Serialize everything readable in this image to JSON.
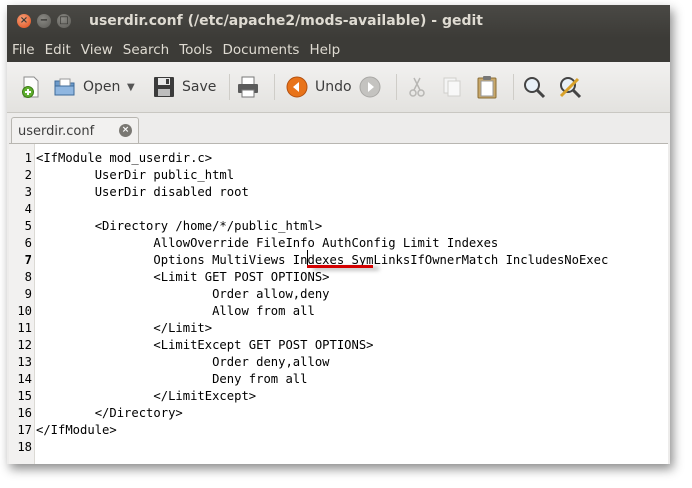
{
  "window": {
    "title": "userdir.conf (/etc/apache2/mods-available) - gedit",
    "controls": {
      "close": "×",
      "minimize": "−",
      "maximize": "□"
    }
  },
  "menubar": [
    "File",
    "Edit",
    "View",
    "Search",
    "Tools",
    "Documents",
    "Help"
  ],
  "toolbar": {
    "new_icon": "new-document-icon",
    "open_label": "Open",
    "save_label": "Save",
    "print_icon": "printer-icon",
    "undo_label": "Undo",
    "redo_icon": "redo-icon",
    "cut_icon": "scissors-icon",
    "copy_icon": "copy-icon",
    "paste_icon": "clipboard-icon",
    "find_icon": "magnifier-icon",
    "replace_icon": "find-replace-icon",
    "dropdown_arrow": "▼"
  },
  "tab": {
    "label": "userdir.conf",
    "close_glyph": "×"
  },
  "editor": {
    "lines": [
      "<IfModule mod_userdir.c>",
      "        UserDir public_html",
      "        UserDir disabled root",
      "",
      "        <Directory /home/*/public_html>",
      "                AllowOverride FileInfo AuthConfig Limit Indexes",
      "                Options MultiViews Indexes SymLinksIfOwnerMatch IncludesNoExec",
      "                <Limit GET POST OPTIONS>",
      "                        Order allow,deny",
      "                        Allow from all",
      "                </Limit>",
      "                <LimitExcept GET POST OPTIONS>",
      "                        Order deny,allow",
      "                        Deny from all",
      "                </LimitExcept>",
      "        </Directory>",
      "</IfModule>",
      ""
    ],
    "line_numbers": [
      "1",
      "2",
      "3",
      "4",
      "5",
      "6",
      "7",
      "8",
      "9",
      "10",
      "11",
      "12",
      "13",
      "14",
      "15",
      "16",
      "17",
      "18"
    ],
    "cursor_line": 7
  },
  "colors": {
    "titlebar": "#3c3b37",
    "close_button": "#df4a16",
    "annotation_underline": "#d40000"
  }
}
